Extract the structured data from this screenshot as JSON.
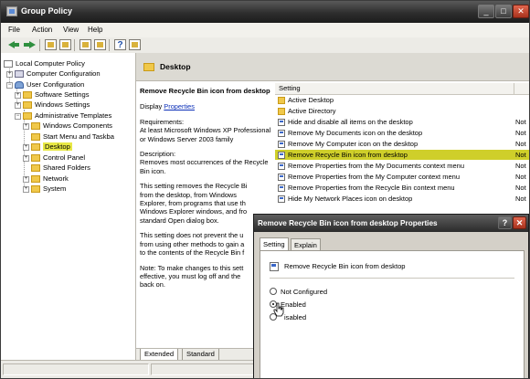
{
  "window": {
    "title": "Group Policy"
  },
  "menubar": [
    "File",
    "Action",
    "View",
    "Help"
  ],
  "tree": [
    {
      "label": "Local Computer Policy",
      "icon": "policy-icon"
    },
    {
      "label": "Computer Configuration",
      "icon": "computer-icon"
    },
    {
      "label": "User Configuration",
      "icon": "user-icon"
    },
    {
      "label": "Software Settings",
      "icon": "folder-icon"
    },
    {
      "label": "Windows Settings",
      "icon": "folder-icon"
    },
    {
      "label": "Administrative Templates",
      "icon": "folder-icon"
    },
    {
      "label": "Windows Components",
      "icon": "folder-icon"
    },
    {
      "label": "Start Menu and Taskba",
      "icon": "folder-icon"
    },
    {
      "label": "Desktop",
      "icon": "folder-icon",
      "selected": true
    },
    {
      "label": "Control Panel",
      "icon": "folder-icon"
    },
    {
      "label": "Shared Folders",
      "icon": "folder-icon"
    },
    {
      "label": "Network",
      "icon": "folder-icon"
    },
    {
      "label": "System",
      "icon": "folder-icon"
    }
  ],
  "main": {
    "header": "Desktop",
    "description": {
      "title": "Remove Recycle Bin icon from desktop",
      "display_prefix": "Display",
      "display_link": "Properties",
      "req_label": "Requirements:",
      "req_text": "At least Microsoft Windows XP Professional or Windows Server 2003 family",
      "desc_label": "Description:",
      "desc_text": "Removes most occurrences of the Recycle Bin icon.",
      "p1": "This setting removes the Recycle Bi",
      "p1b": "from the desktop, from Windows",
      "p1c": "Explorer, from programs that use th",
      "p1d": "Windows Explorer windows, and fro",
      "p1e": "standard Open dialog box.",
      "p2": "This setting does not prevent the u",
      "p2b": "from using other methods to gain a",
      "p2c": "to the contents of the Recycle Bin f",
      "p3": "Note: To make changes to this sett",
      "p3b": "effective, you must log off and the",
      "p3c": "back on."
    },
    "list": {
      "col_setting": "Setting",
      "col_state": "",
      "items": [
        {
          "label": "Active Desktop",
          "type": "folder",
          "state": ""
        },
        {
          "label": "Active Directory",
          "type": "folder",
          "state": ""
        },
        {
          "label": "Hide and disable all items on the desktop",
          "type": "policy",
          "state": "Not"
        },
        {
          "label": "Remove My Documents icon on the desktop",
          "type": "policy",
          "state": "Not"
        },
        {
          "label": "Remove My Computer icon on the desktop",
          "type": "policy",
          "state": "Not"
        },
        {
          "label": "Remove Recycle Bin icon from desktop",
          "type": "policy",
          "state": "Not",
          "selected": true
        },
        {
          "label": "Remove Properties from the My Documents context menu",
          "type": "policy",
          "state": "Not"
        },
        {
          "label": "Remove Properties from the My Computer context menu",
          "type": "policy",
          "state": "Not"
        },
        {
          "label": "Remove Properties from the Recycle Bin context menu",
          "type": "policy",
          "state": "Not"
        },
        {
          "label": "Hide My Network Places icon on desktop",
          "type": "policy",
          "state": "Not"
        }
      ]
    },
    "bottom_tabs": [
      "Extended",
      "Standard"
    ]
  },
  "dialog": {
    "title": "Remove Recycle Bin icon from desktop Properties",
    "tabs": [
      "Setting",
      "Explain"
    ],
    "policy_name": "Remove Recycle Bin icon from desktop",
    "options": [
      {
        "label": "Not Configured",
        "checked": false
      },
      {
        "label": "Enabled",
        "checked": true
      },
      {
        "label": "isabled",
        "checked": false
      }
    ]
  }
}
